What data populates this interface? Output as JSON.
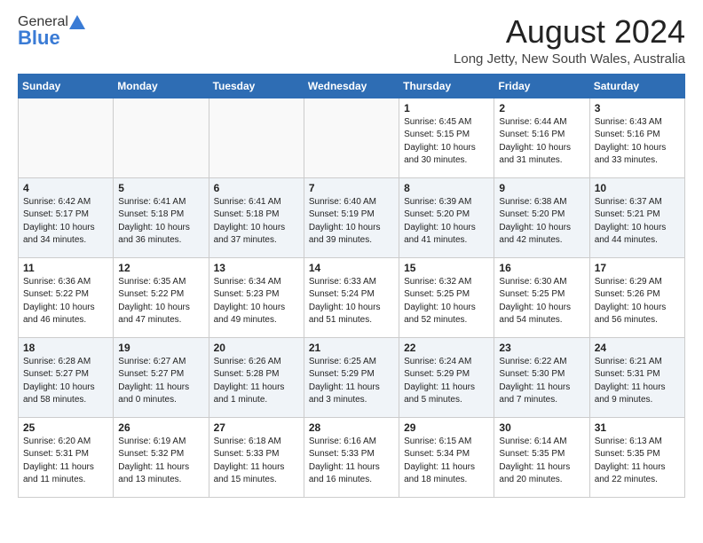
{
  "header": {
    "logo_general": "General",
    "logo_blue": "Blue",
    "month_year": "August 2024",
    "location": "Long Jetty, New South Wales, Australia"
  },
  "days_of_week": [
    "Sunday",
    "Monday",
    "Tuesday",
    "Wednesday",
    "Thursday",
    "Friday",
    "Saturday"
  ],
  "weeks": [
    [
      {
        "day": "",
        "info": ""
      },
      {
        "day": "",
        "info": ""
      },
      {
        "day": "",
        "info": ""
      },
      {
        "day": "",
        "info": ""
      },
      {
        "day": "1",
        "info": "Sunrise: 6:45 AM\nSunset: 5:15 PM\nDaylight: 10 hours\nand 30 minutes."
      },
      {
        "day": "2",
        "info": "Sunrise: 6:44 AM\nSunset: 5:16 PM\nDaylight: 10 hours\nand 31 minutes."
      },
      {
        "day": "3",
        "info": "Sunrise: 6:43 AM\nSunset: 5:16 PM\nDaylight: 10 hours\nand 33 minutes."
      }
    ],
    [
      {
        "day": "4",
        "info": "Sunrise: 6:42 AM\nSunset: 5:17 PM\nDaylight: 10 hours\nand 34 minutes."
      },
      {
        "day": "5",
        "info": "Sunrise: 6:41 AM\nSunset: 5:18 PM\nDaylight: 10 hours\nand 36 minutes."
      },
      {
        "day": "6",
        "info": "Sunrise: 6:41 AM\nSunset: 5:18 PM\nDaylight: 10 hours\nand 37 minutes."
      },
      {
        "day": "7",
        "info": "Sunrise: 6:40 AM\nSunset: 5:19 PM\nDaylight: 10 hours\nand 39 minutes."
      },
      {
        "day": "8",
        "info": "Sunrise: 6:39 AM\nSunset: 5:20 PM\nDaylight: 10 hours\nand 41 minutes."
      },
      {
        "day": "9",
        "info": "Sunrise: 6:38 AM\nSunset: 5:20 PM\nDaylight: 10 hours\nand 42 minutes."
      },
      {
        "day": "10",
        "info": "Sunrise: 6:37 AM\nSunset: 5:21 PM\nDaylight: 10 hours\nand 44 minutes."
      }
    ],
    [
      {
        "day": "11",
        "info": "Sunrise: 6:36 AM\nSunset: 5:22 PM\nDaylight: 10 hours\nand 46 minutes."
      },
      {
        "day": "12",
        "info": "Sunrise: 6:35 AM\nSunset: 5:22 PM\nDaylight: 10 hours\nand 47 minutes."
      },
      {
        "day": "13",
        "info": "Sunrise: 6:34 AM\nSunset: 5:23 PM\nDaylight: 10 hours\nand 49 minutes."
      },
      {
        "day": "14",
        "info": "Sunrise: 6:33 AM\nSunset: 5:24 PM\nDaylight: 10 hours\nand 51 minutes."
      },
      {
        "day": "15",
        "info": "Sunrise: 6:32 AM\nSunset: 5:25 PM\nDaylight: 10 hours\nand 52 minutes."
      },
      {
        "day": "16",
        "info": "Sunrise: 6:30 AM\nSunset: 5:25 PM\nDaylight: 10 hours\nand 54 minutes."
      },
      {
        "day": "17",
        "info": "Sunrise: 6:29 AM\nSunset: 5:26 PM\nDaylight: 10 hours\nand 56 minutes."
      }
    ],
    [
      {
        "day": "18",
        "info": "Sunrise: 6:28 AM\nSunset: 5:27 PM\nDaylight: 10 hours\nand 58 minutes."
      },
      {
        "day": "19",
        "info": "Sunrise: 6:27 AM\nSunset: 5:27 PM\nDaylight: 11 hours\nand 0 minutes."
      },
      {
        "day": "20",
        "info": "Sunrise: 6:26 AM\nSunset: 5:28 PM\nDaylight: 11 hours\nand 1 minute."
      },
      {
        "day": "21",
        "info": "Sunrise: 6:25 AM\nSunset: 5:29 PM\nDaylight: 11 hours\nand 3 minutes."
      },
      {
        "day": "22",
        "info": "Sunrise: 6:24 AM\nSunset: 5:29 PM\nDaylight: 11 hours\nand 5 minutes."
      },
      {
        "day": "23",
        "info": "Sunrise: 6:22 AM\nSunset: 5:30 PM\nDaylight: 11 hours\nand 7 minutes."
      },
      {
        "day": "24",
        "info": "Sunrise: 6:21 AM\nSunset: 5:31 PM\nDaylight: 11 hours\nand 9 minutes."
      }
    ],
    [
      {
        "day": "25",
        "info": "Sunrise: 6:20 AM\nSunset: 5:31 PM\nDaylight: 11 hours\nand 11 minutes."
      },
      {
        "day": "26",
        "info": "Sunrise: 6:19 AM\nSunset: 5:32 PM\nDaylight: 11 hours\nand 13 minutes."
      },
      {
        "day": "27",
        "info": "Sunrise: 6:18 AM\nSunset: 5:33 PM\nDaylight: 11 hours\nand 15 minutes."
      },
      {
        "day": "28",
        "info": "Sunrise: 6:16 AM\nSunset: 5:33 PM\nDaylight: 11 hours\nand 16 minutes."
      },
      {
        "day": "29",
        "info": "Sunrise: 6:15 AM\nSunset: 5:34 PM\nDaylight: 11 hours\nand 18 minutes."
      },
      {
        "day": "30",
        "info": "Sunrise: 6:14 AM\nSunset: 5:35 PM\nDaylight: 11 hours\nand 20 minutes."
      },
      {
        "day": "31",
        "info": "Sunrise: 6:13 AM\nSunset: 5:35 PM\nDaylight: 11 hours\nand 22 minutes."
      }
    ]
  ]
}
